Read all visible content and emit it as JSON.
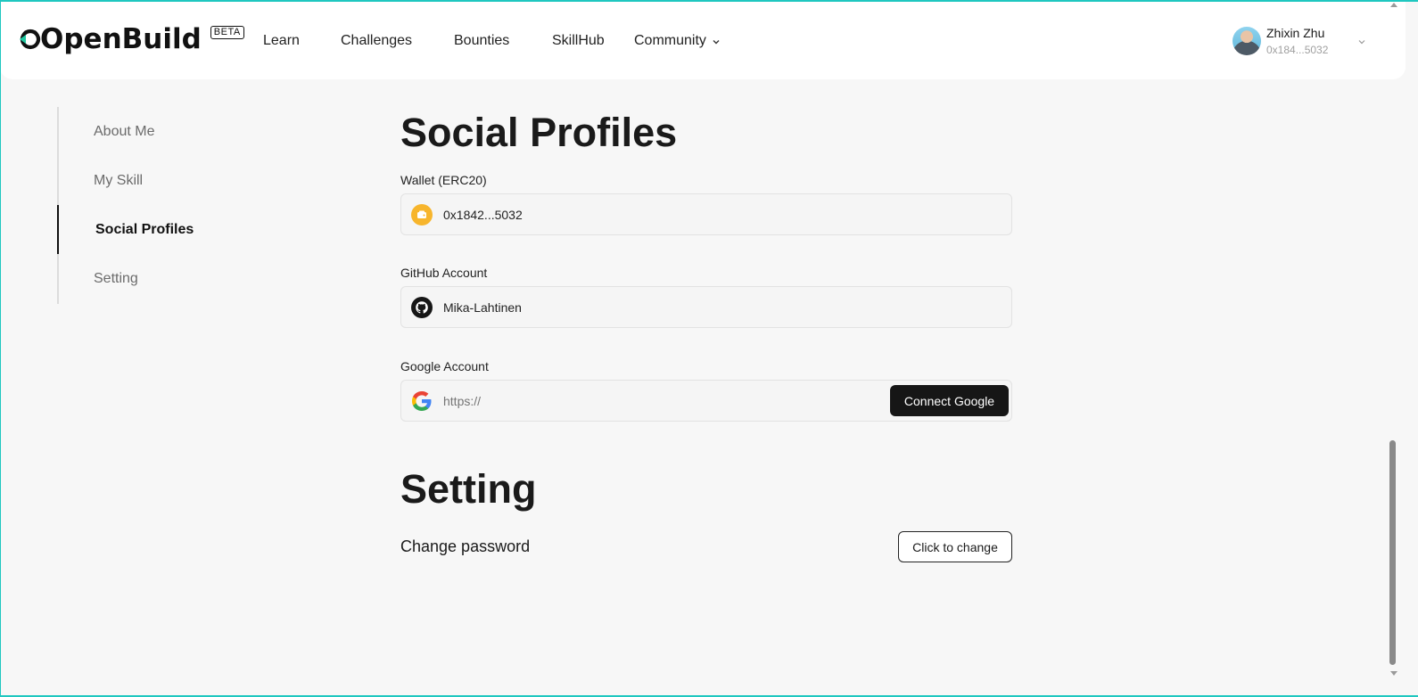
{
  "brand": {
    "name": "OpenBuild",
    "badge": "BETA",
    "accent": "#1fc7c0"
  },
  "nav": {
    "items": [
      {
        "label": "Learn"
      },
      {
        "label": "Challenges"
      },
      {
        "label": "Bounties"
      },
      {
        "label": "SkillHub"
      },
      {
        "label": "Community"
      }
    ]
  },
  "user": {
    "name": "Zhixin Zhu",
    "address": "0x184...5032"
  },
  "sidebar": {
    "items": [
      {
        "label": "About Me"
      },
      {
        "label": "My Skill"
      },
      {
        "label": "Social Profiles",
        "active": true
      },
      {
        "label": "Setting"
      }
    ]
  },
  "social": {
    "title": "Social Profiles",
    "wallet": {
      "label": "Wallet (ERC20)",
      "value": "0x1842...5032",
      "icon": "wallet-icon"
    },
    "github": {
      "label": "GitHub Account",
      "value": "Mika-Lahtinen",
      "icon": "github-icon"
    },
    "google": {
      "label": "Google Account",
      "placeholder": "https://",
      "button": "Connect Google",
      "icon": "google-icon"
    }
  },
  "setting": {
    "title": "Setting",
    "change_password_label": "Change password",
    "change_button": "Click to change"
  }
}
